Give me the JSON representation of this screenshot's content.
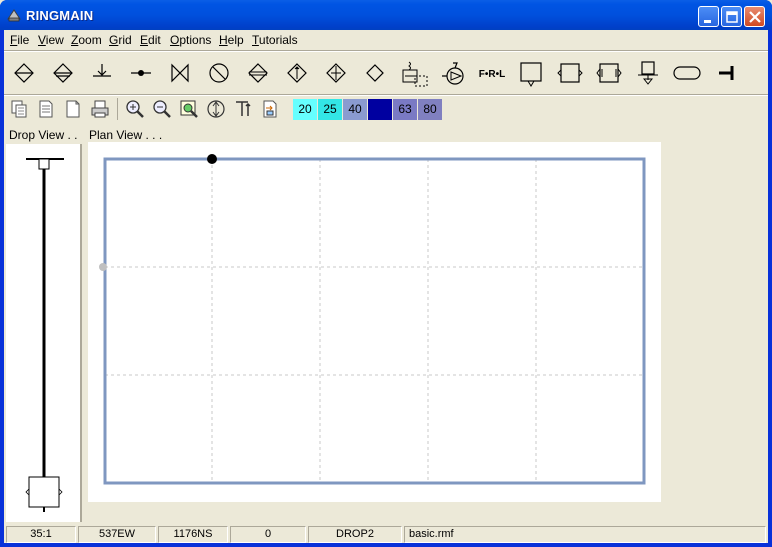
{
  "window": {
    "title": "RINGMAIN"
  },
  "menu": [
    {
      "label": "File",
      "underline": "F",
      "rest": "ile"
    },
    {
      "label": "View",
      "underline": "V",
      "rest": "iew"
    },
    {
      "label": "Zoom",
      "underline": "Z",
      "rest": "oom"
    },
    {
      "label": "Grid",
      "underline": "G",
      "rest": "rid"
    },
    {
      "label": "Edit",
      "underline": "E",
      "rest": "dit"
    },
    {
      "label": "Options",
      "underline": "O",
      "rest": "ptions"
    },
    {
      "label": "Help",
      "underline": "H",
      "rest": "elp"
    },
    {
      "label": "Tutorials",
      "underline": "T",
      "rest": "utorials"
    }
  ],
  "toolbar": {
    "frl_label": "F•R•L"
  },
  "diameters": [
    {
      "label": "20",
      "color": "#66ffff"
    },
    {
      "label": "25",
      "color": "#33e6e6"
    },
    {
      "label": "40",
      "color": "#8a9bd0"
    },
    {
      "label": "50",
      "color": "#0000a0"
    },
    {
      "label": "63",
      "color": "#7a7ac4"
    },
    {
      "label": "80",
      "color": "#8080c0"
    }
  ],
  "panels": {
    "drop_view_label": "Drop View . . .",
    "plan_view_label": "Plan View . . ."
  },
  "status": {
    "scale": "35:1",
    "easting": "537EW",
    "northing": "1176NS",
    "value": "0",
    "drop": "DROP2",
    "file": "basic.rmf"
  }
}
